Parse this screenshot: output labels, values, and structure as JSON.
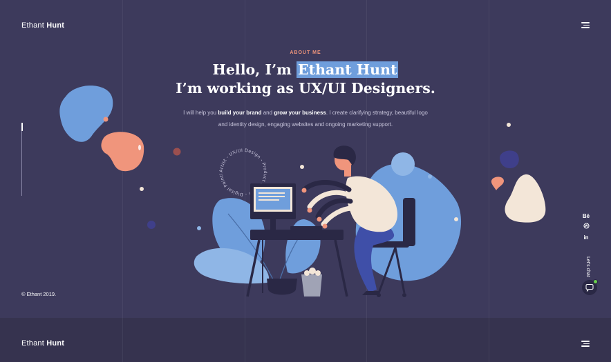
{
  "brand": {
    "first": "Ethant ",
    "last": "Hunt"
  },
  "hero": {
    "eyebrow": "ABOUT ME",
    "line1_prefix": "Hello, I’m ",
    "line1_name": "Ethant Hunt",
    "line2": "I’m working as UX/UI Designers.",
    "intro": {
      "p1": "I will help you ",
      "b1": "build your brand",
      "p2": " and ",
      "b2": "grow your business",
      "p3": ". I create clarifying strategy, beautiful logo",
      "line2": "and identity design, engaging websites and ongoing marketing support."
    }
  },
  "badge_text": "Artist - UX/UI Design - Product Design - Digital Painting - ",
  "copyright": "© Ethant 2019.",
  "social": {
    "behance": "Bē",
    "dribbble_icon": "dribbble-icon",
    "linkedin": "in"
  },
  "lets_chat": "Let's chat",
  "footer": {
    "brand_first": "Ethant ",
    "brand_last": "Hunt"
  },
  "colors": {
    "background": "#3d3a5c",
    "footer_bg": "#36334f",
    "accent_orange": "#f0957c",
    "accent_blue": "#6f9edc",
    "chat_online": "#6ad04d"
  }
}
